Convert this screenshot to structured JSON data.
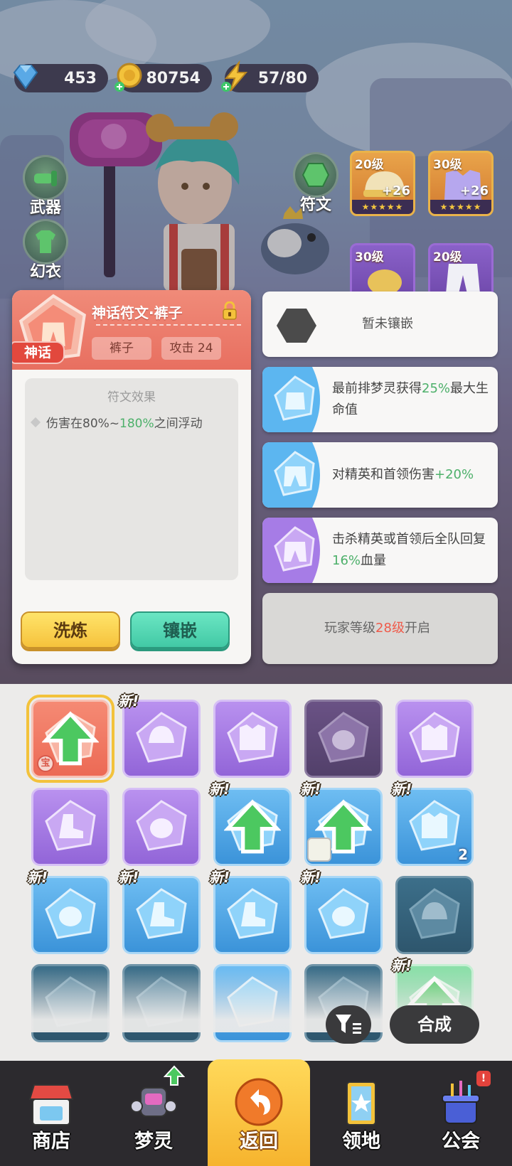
{
  "resources": {
    "diamonds": "453",
    "coins": "80754",
    "energy": "57/80"
  },
  "left_menu": {
    "weapon": "武器",
    "outfit": "幻衣"
  },
  "right_menu": {
    "rune": "符文"
  },
  "gear_cards": [
    {
      "level": "20级",
      "plus": "+26",
      "stars": "★★★★★"
    },
    {
      "level": "30级",
      "plus": "+26",
      "stars": "★★★★★"
    },
    {
      "level": "30级"
    },
    {
      "level": "20级"
    }
  ],
  "detail": {
    "title": "神话符文·裤子",
    "rarity_badge": "神话",
    "slot_type": "裤子",
    "stat_label": "攻击",
    "stat_value": "24",
    "effect_title": "符文效果",
    "effect_pre": "伤害在80%~",
    "effect_highlight": "180%",
    "effect_post": "之间浮动",
    "refine_button": "洗炼",
    "inlay_button": "镶嵌"
  },
  "slots": [
    {
      "text": "暂未镶嵌"
    },
    {
      "pre": "最前排梦灵获得",
      "highlight": "25%",
      "post": "最大生命值"
    },
    {
      "pre": "对精英和首领伤害",
      "highlight": "+20%",
      "post": ""
    },
    {
      "pre": "击杀精英或首领后全队回复",
      "highlight": "16%",
      "post": "血量"
    },
    {
      "pre": "玩家等级",
      "highlight": "28级",
      "post": "开启"
    }
  ],
  "inventory": {
    "new_label": "新!",
    "treasure_label": "宝",
    "count_label": "2",
    "compose_button": "合成"
  },
  "nav": {
    "shop": "商店",
    "spirit": "梦灵",
    "back": "返回",
    "territory": "领地",
    "guild": "公会",
    "guild_badge": "!"
  },
  "colors": {
    "highlight_green": "#4db06a",
    "highlight_red": "#ef5a4a",
    "myth_red": "#e86f60",
    "button_yellow": "#f6c23c",
    "button_teal": "#42c9a5"
  }
}
